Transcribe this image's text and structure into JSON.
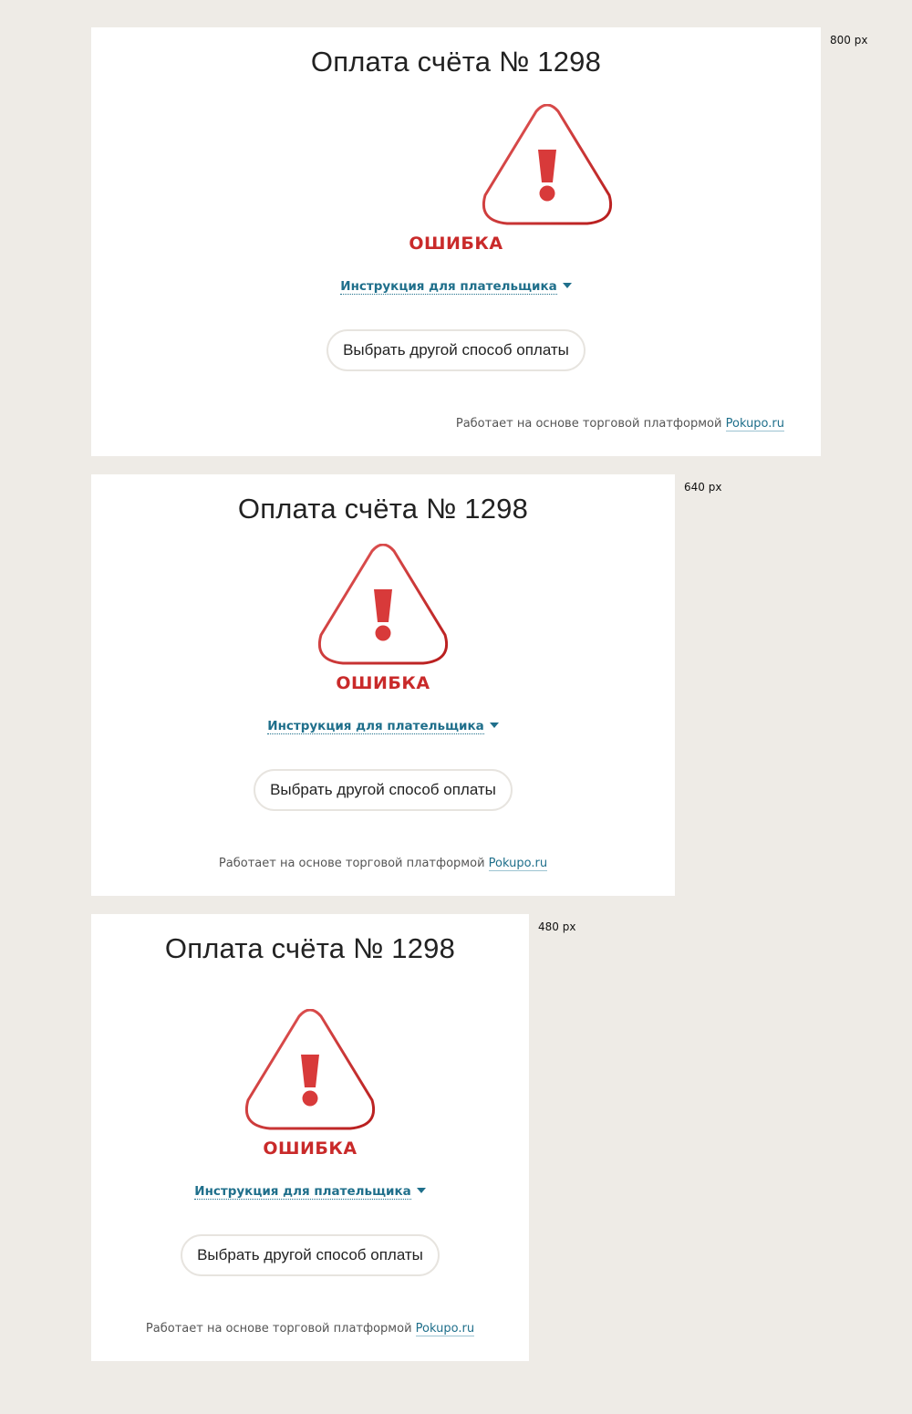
{
  "panels": [
    {
      "size_label": "800 px",
      "title": "Оплата счёта № 1298",
      "status_text": "ОШИБКА",
      "instruction_link": "Инструкция для плательщика",
      "alt_payment_button": "Выбрать другой способ оплаты",
      "powered_text": "Работает на основе торговой платформой",
      "powered_link": "Pokupo.ru"
    },
    {
      "size_label": "640 px",
      "title": "Оплата счёта № 1298",
      "status_text": "ОШИБКА",
      "instruction_link": "Инструкция для плательщика",
      "alt_payment_button": "Выбрать другой способ оплаты",
      "powered_text": "Работает на основе торговой платформой",
      "powered_link": "Pokupo.ru"
    },
    {
      "size_label": "480 px",
      "title": "Оплата счёта № 1298",
      "status_text": "ОШИБКА",
      "instruction_link": "Инструкция для плательщика",
      "alt_payment_button": "Выбрать другой способ оплаты",
      "powered_text": "Работает на основе торговой платформой",
      "powered_link": "Pokupo.ru"
    }
  ],
  "icons": {
    "status": "warning-triangle-icon",
    "dropdown": "caret-down-icon"
  },
  "colors": {
    "background": "#eeebe6",
    "panel": "#ffffff",
    "error_red": "#c92a2a",
    "link_blue": "#1f6f8b",
    "button_border": "#e7e4df"
  }
}
